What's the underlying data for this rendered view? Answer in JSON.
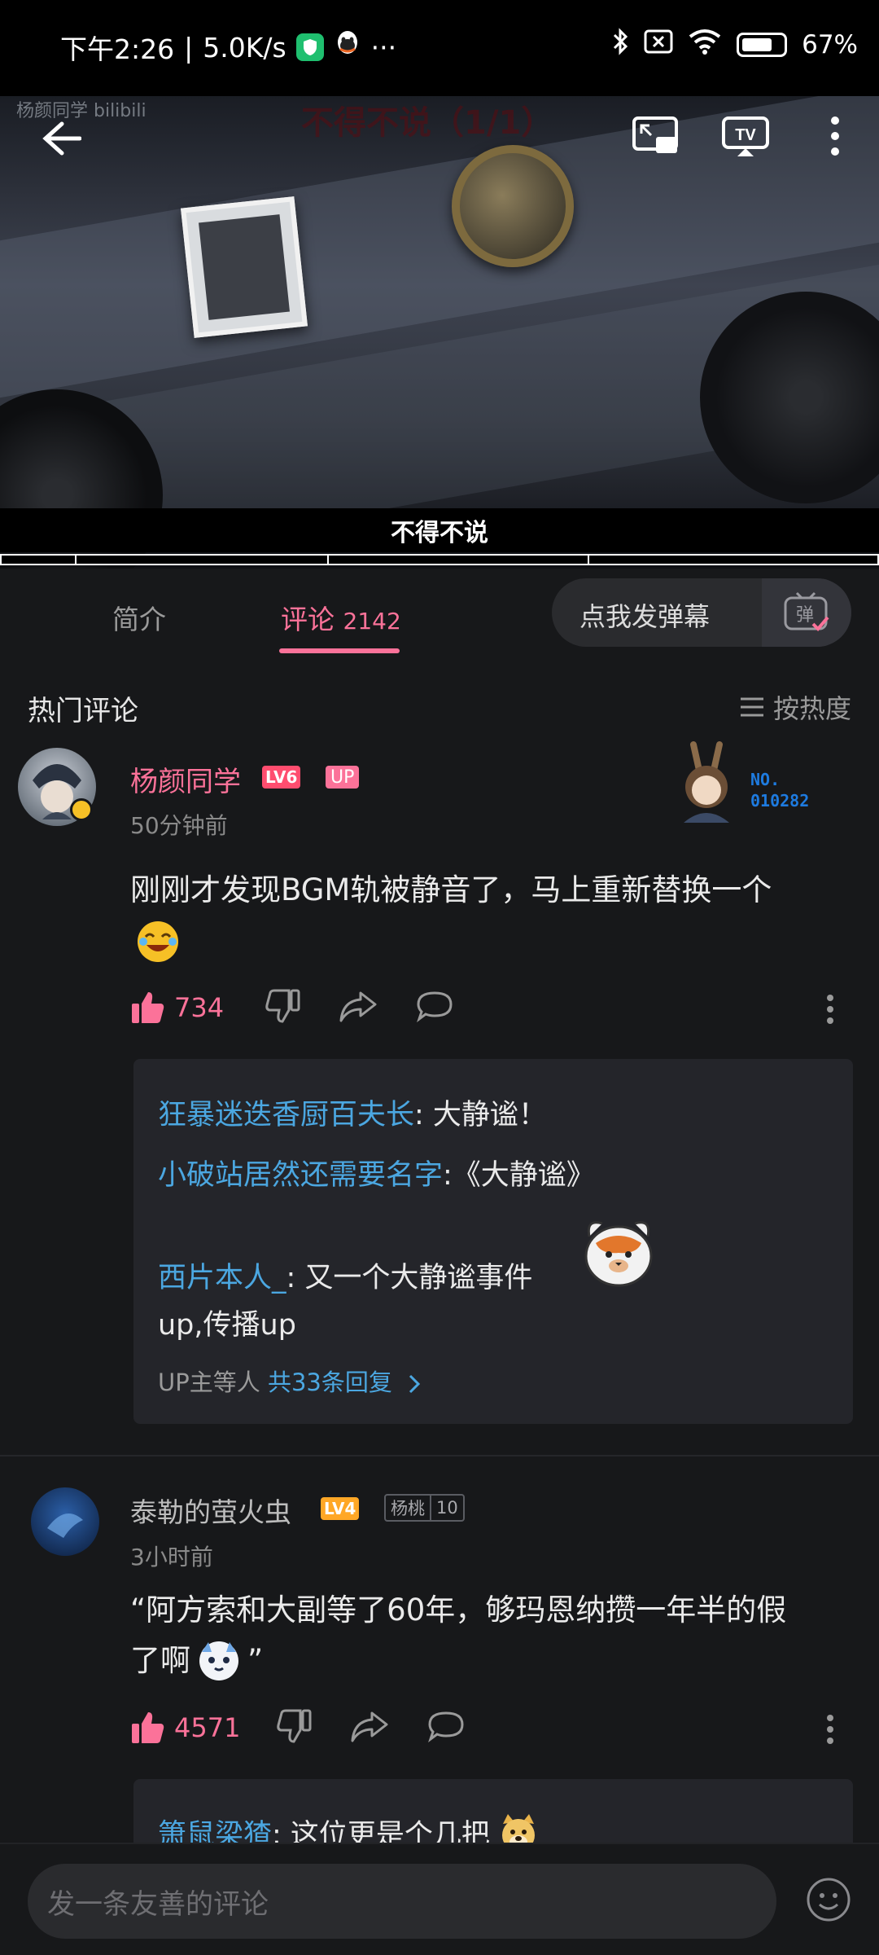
{
  "status_bar": {
    "time": "下午2:26",
    "network_speed": "5.0K/s",
    "more": "···",
    "battery": "67%",
    "battery_level": 0.67
  },
  "video": {
    "watermark": "杨颜同学 bilibili",
    "overlay_title": "不得不说（1/1）",
    "subtitle": "不得不说"
  },
  "tabs": {
    "intro": "简介",
    "comments": "评论",
    "comments_count": "2142"
  },
  "danmu": {
    "label": "点我发弹幕",
    "button_glyph": "弹"
  },
  "comments_header": {
    "title": "热门评论",
    "sort": "按热度"
  },
  "comments": [
    {
      "username": "杨颜同学",
      "level": "LV6",
      "up_tag": "UP",
      "time": "50分钟前",
      "decoration_no": "NO.",
      "decoration_id": "010282",
      "content": "刚刚才发现BGM轨被静音了，马上重新替换一个",
      "likes": "734",
      "replies": [
        {
          "user": "狂暴迷迭香厨百夫长",
          "text": ": 大静谧！"
        },
        {
          "user": "小破站居然还需要名字",
          "text": ":《大静谧》"
        },
        {
          "user": "西片本人_",
          "text": ": 又一个大静谧事件"
        }
      ],
      "reply_extra_line": "up,传播up",
      "reply_footer_prefix": "UP主等人",
      "reply_footer_total": "共33条回复"
    },
    {
      "username": "泰勒的萤火虫",
      "level": "LV4",
      "fan_badge_name": "杨桃",
      "fan_badge_level": "10",
      "time": "3小时前",
      "content_line1": "“阿方索和大副等了60年，够玛恩纳攒一年半的假",
      "content_line2": "了啊",
      "content_end": "”",
      "likes": "4571",
      "replies": [
        {
          "user": "箫鼠梁猹",
          "text": ": 这位更是个几把"
        }
      ]
    }
  ],
  "input": {
    "placeholder": "发一条友善的评论"
  }
}
